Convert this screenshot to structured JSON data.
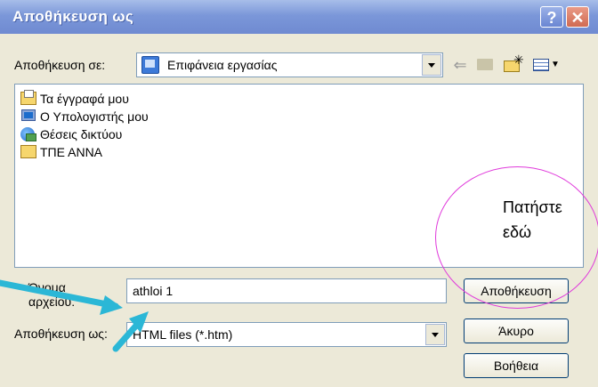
{
  "window": {
    "title": "Αποθήκευση ως",
    "help_glyph": "?",
    "close_glyph": "✕"
  },
  "save_in": {
    "label": "Αποθήκευση σε:",
    "value": "Επιφάνεια εργασίας",
    "icon": "desktop-icon"
  },
  "toolbar": {
    "back_icon": "back-arrow-icon",
    "up_icon": "up-folder-icon",
    "new_folder_icon": "new-folder-icon",
    "views_icon": "views-menu-icon"
  },
  "files": [
    {
      "label": "Τα έγγραφά μου",
      "icon": "my-documents-icon"
    },
    {
      "label": "Ο Υπολογιστής μου",
      "icon": "my-computer-icon"
    },
    {
      "label": "Θέσεις δικτύου",
      "icon": "network-places-icon"
    },
    {
      "label": "ΤΠΕ ΑΝΝΑ",
      "icon": "folder-icon"
    }
  ],
  "filename": {
    "label_line1": "Όνομα",
    "label_line2": "αρχείου:",
    "value": "athloi 1"
  },
  "savetype": {
    "label": "Αποθήκευση ως:",
    "value": "HTML files (*.htm)"
  },
  "buttons": {
    "save": "Αποθήκευση",
    "cancel": "Άκυρο",
    "help": "Βοήθεια"
  },
  "annotation": {
    "line1": "Πατήστε",
    "line2": "εδώ",
    "circle_color": "#e03adb",
    "arrow_color": "#2bb7d6"
  }
}
